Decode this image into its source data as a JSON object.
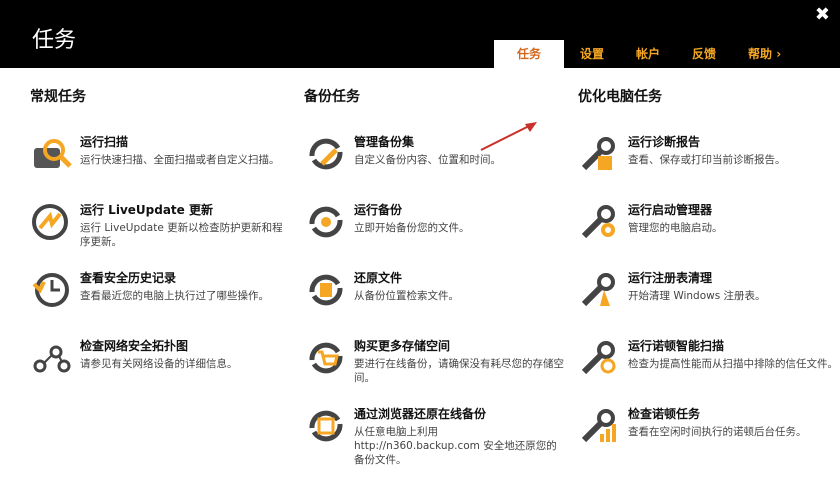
{
  "window": {
    "title": "任务",
    "close_glyph": "✖"
  },
  "tabs": [
    {
      "label": "任务",
      "active": true
    },
    {
      "label": "设置"
    },
    {
      "label": "帐户"
    },
    {
      "label": "反馈"
    },
    {
      "label": "帮助 ›"
    }
  ],
  "columns": [
    {
      "heading": "常规任务",
      "tasks": [
        {
          "name": "运行扫描",
          "desc": "运行快速扫描、全面扫描或者自定义扫描。",
          "icon": "scan-icon"
        },
        {
          "name": "运行 LiveUpdate 更新",
          "desc": "运行 LiveUpdate 更新以检查防护更新和程序更新。",
          "icon": "liveupdate-icon"
        },
        {
          "name": "查看安全历史记录",
          "desc": "查看最近您的电脑上执行过了哪些操作。",
          "icon": "history-icon"
        },
        {
          "name": "检查网络安全拓扑图",
          "desc": "请参见有关网络设备的详细信息。",
          "icon": "network-map-icon"
        }
      ]
    },
    {
      "heading": "备份任务",
      "tasks": [
        {
          "name": "管理备份集",
          "desc": "自定义备份内容、位置和时间。",
          "icon": "backup-sets-icon"
        },
        {
          "name": "运行备份",
          "desc": "立即开始备份您的文件。",
          "icon": "run-backup-icon"
        },
        {
          "name": "还原文件",
          "desc": "从备份位置检索文件。",
          "icon": "restore-files-icon"
        },
        {
          "name": "购买更多存储空间",
          "desc": "要进行在线备份，请确保没有耗尽您的存储空间。",
          "icon": "buy-storage-icon"
        },
        {
          "name": "通过浏览器还原在线备份",
          "desc": "从任意电脑上利用 http://n360.backup.com 安全地还原您的备份文件。",
          "icon": "browser-restore-icon"
        }
      ]
    },
    {
      "heading": "优化电脑任务",
      "tasks": [
        {
          "name": "运行诊断报告",
          "desc": "查看、保存或打印当前诊断报告。",
          "icon": "diagnostic-report-icon"
        },
        {
          "name": "运行启动管理器",
          "desc": "管理您的电脑启动。",
          "icon": "startup-manager-icon"
        },
        {
          "name": "运行注册表清理",
          "desc": "开始清理 Windows 注册表。",
          "icon": "registry-cleanup-icon"
        },
        {
          "name": "运行诺顿智能扫描",
          "desc": "检查为提高性能而从扫描中排除的信任文件。",
          "icon": "insight-scan-icon"
        },
        {
          "name": "检查诺顿任务",
          "desc": "查看在空闲时间执行的诺顿后台任务。",
          "icon": "background-jobs-icon"
        }
      ]
    }
  ],
  "colors": {
    "accent": "#f5a623",
    "active_tab_text": "#d2691e",
    "arrow": "#c8302c",
    "header_bg": "#000000"
  }
}
